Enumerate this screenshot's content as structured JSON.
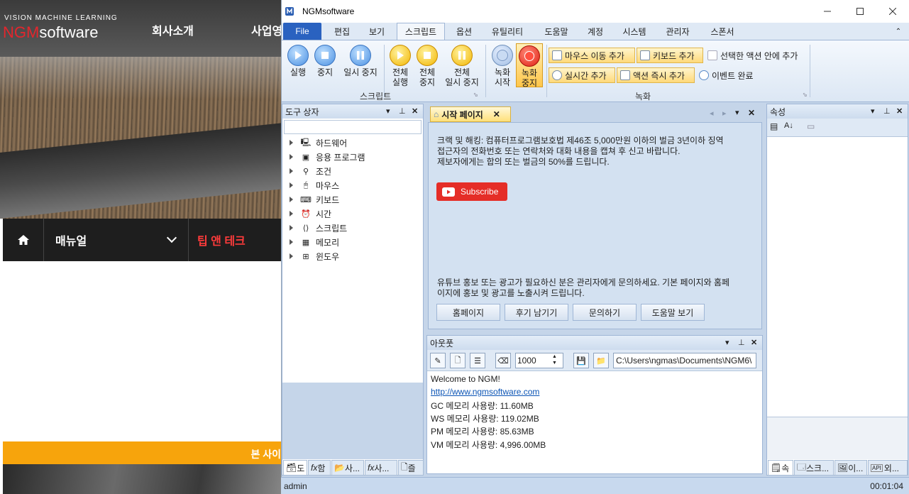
{
  "site": {
    "logo_sub": "VISION MACHINE LEARNING",
    "logo_red": "NGM",
    "logo_rest": "software",
    "nav": [
      "회사소개",
      "사업영"
    ],
    "menu_manual": "매뉴얼",
    "menu_tips": "팁 앤 테크",
    "orange_text": "본 사이"
  },
  "window": {
    "title": "NGMsoftware",
    "menu_tabs": [
      "File",
      "편집",
      "보기",
      "스크립트",
      "옵션",
      "유틸리티",
      "도움말",
      "계정",
      "시스템",
      "관리자",
      "스폰서"
    ],
    "active_tab": "스크립트"
  },
  "ribbon": {
    "script_group": {
      "label": "스크립트",
      "run": "실행",
      "stop": "중지",
      "pause": "일시 중지",
      "run_all": [
        "전체",
        "실행"
      ],
      "stop_all": [
        "전체",
        "중지"
      ],
      "pause_all": [
        "전체",
        "일시 중지"
      ]
    },
    "record_group": {
      "label": "녹화",
      "rec_start": [
        "녹화",
        "시작"
      ],
      "rec_stop": [
        "녹화",
        "중지"
      ],
      "add_mouse": "마우스 이동 추가",
      "add_keyboard": "키보드 추가",
      "add_in_selected": "선택한 액션 안에 추가",
      "add_realtime": "실시간 추가",
      "add_instant": "액션 즉시 추가",
      "event_done": "이벤트 완료"
    }
  },
  "toolbox": {
    "title": "도구 상자",
    "items": [
      "하드웨어",
      "응용 프로그램",
      "조건",
      "마우스",
      "키보드",
      "시간",
      "스크립트",
      "메모리",
      "윈도우"
    ],
    "bottom_tabs": [
      "도",
      "함",
      "사...",
      "사...",
      "즐"
    ]
  },
  "start_page": {
    "tab_label": "시작 페이지",
    "notice_line1": "크랙 및 해킹: 컴퓨터프로그램보호법 제46조 5,000만원 이하의 벌금 3년이하 징역",
    "notice_line2": "접근자의 전화번호 또는 연락처와 대화 내용을 캡쳐 후 신고 바랍니다.",
    "notice_line3": "제보자에게는 합의 또는 벌금의 50%를 드립니다.",
    "subscribe": "Subscribe",
    "promo_line1": "유튜브 홍보 또는 광고가 필요하신 분은 관리자에게 문의하세요. 기본 페이지와 홈페",
    "promo_line2": "이지에 홍보 및 광고를 노출시켜 드립니다.",
    "buttons": [
      "홈페이지",
      "후기 남기기",
      "문의하기",
      "도움말 보기"
    ]
  },
  "output": {
    "title": "아웃풋",
    "count": "1000",
    "path": "C:\\Users\\ngmas\\Documents\\NGM6\\",
    "lines": [
      "Welcome to NGM!",
      "http://www.ngmsoftware.com",
      "GC 메모리 사용량: 11.60MB",
      "WS 메모리 사용량: 119.02MB",
      "PM 메모리 사용량: 85.63MB",
      "VM 메모리 사용량: 4,996.00MB"
    ]
  },
  "properties": {
    "title": "속성",
    "bottom_tabs": [
      "속",
      "스크...",
      "이...",
      "외..."
    ]
  },
  "status": {
    "user": "admin",
    "time": "00:01:04"
  }
}
